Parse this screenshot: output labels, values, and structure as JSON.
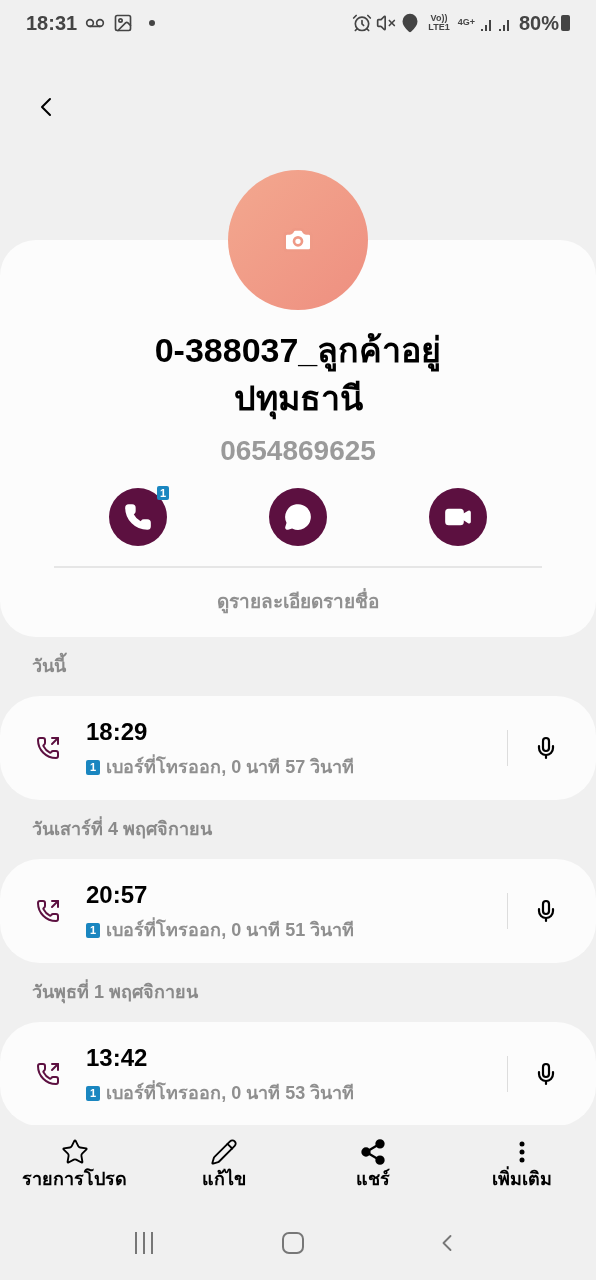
{
  "status_bar": {
    "time": "18:31",
    "volte": "Vo))",
    "volte_sim": "LTE1",
    "network": "4G+",
    "battery": "80%"
  },
  "contact": {
    "name": "0-388037_ลูกค้าอยู่ปทุมธานี",
    "number": "0654869625",
    "details_link": "ดูรายละเอียดรายชื่อ"
  },
  "actions": [
    {
      "kind": "call",
      "badge": "1"
    },
    {
      "kind": "message"
    },
    {
      "kind": "video"
    }
  ],
  "history": [
    {
      "date": "วันนี้",
      "calls": [
        {
          "kind": "outgoing",
          "time": "18:29",
          "sim": "1",
          "description": "เบอร์ที่โทรออก, 0 นาที 57 วินาที"
        }
      ]
    },
    {
      "date": "วันเสาร์ที่ 4 พฤศจิกายน",
      "calls": [
        {
          "kind": "outgoing",
          "time": "20:57",
          "sim": "1",
          "description": "เบอร์ที่โทรออก, 0 นาที 51 วินาที"
        }
      ]
    },
    {
      "date": "วันพุธที่ 1 พฤศจิกายน",
      "calls": [
        {
          "kind": "outgoing",
          "time": "13:42",
          "sim": "1",
          "description": "เบอร์ที่โทรออก, 0 นาที 53 วินาที"
        }
      ]
    }
  ],
  "toolbar": [
    {
      "kind": "favorite",
      "label": "รายการโปรด"
    },
    {
      "kind": "edit",
      "label": "แก้ไข"
    },
    {
      "kind": "share",
      "label": "แชร์"
    },
    {
      "kind": "more",
      "label": "เพิ่มเติม"
    }
  ]
}
